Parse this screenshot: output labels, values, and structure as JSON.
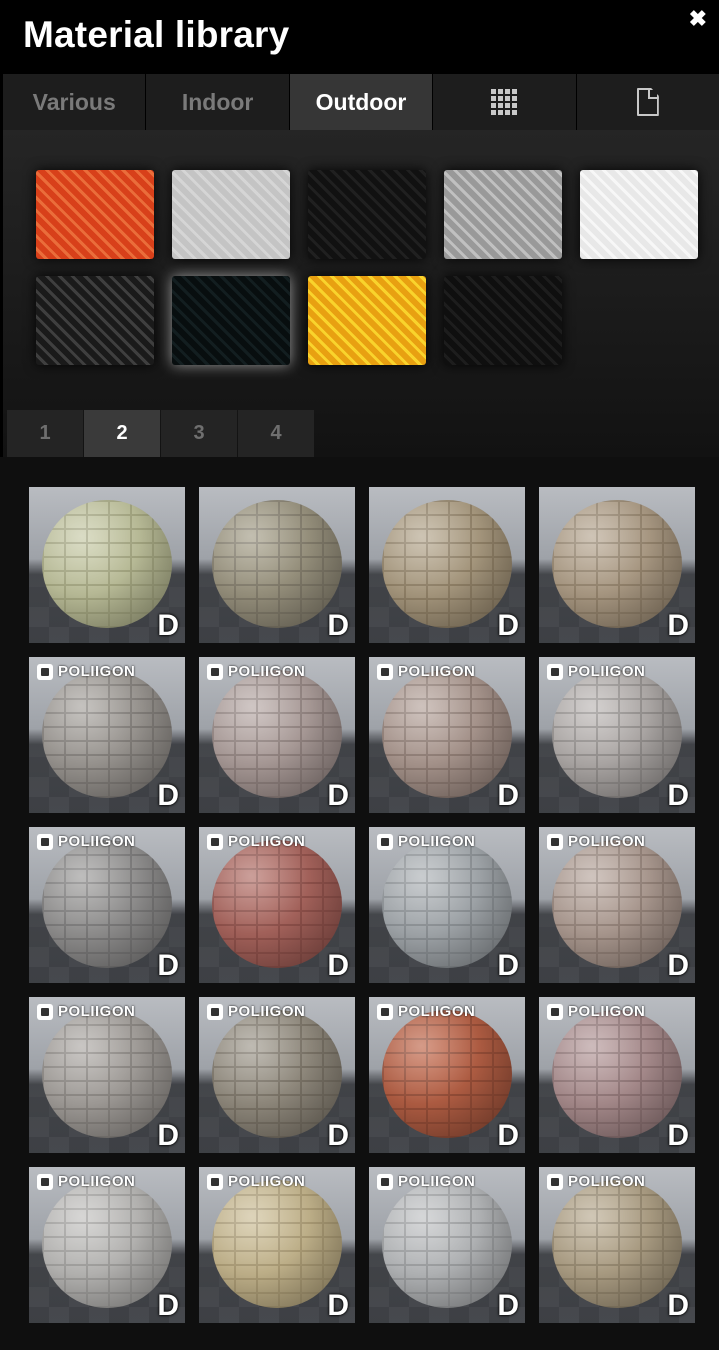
{
  "window": {
    "title": "Material library",
    "close_glyph": "✖"
  },
  "tabs": [
    {
      "label": "Various",
      "active": false
    },
    {
      "label": "Indoor",
      "active": false
    },
    {
      "label": "Outdoor",
      "active": true
    },
    {
      "icon": "grid-icon"
    },
    {
      "icon": "document-icon"
    }
  ],
  "swatches": [
    {
      "name": "brick",
      "colors": [
        "#b85a3a",
        "#d99a80"
      ]
    },
    {
      "name": "concrete",
      "colors": [
        "#a8a8a8",
        "#c2c2c2"
      ]
    },
    {
      "name": "glossy-dark",
      "colors": [
        "#2e2e2e",
        "#5a5a5a"
      ]
    },
    {
      "name": "metal-tread-plate",
      "colors": [
        "#8d8d8d",
        "#b8b8b8"
      ]
    },
    {
      "name": "white-plaster",
      "colors": [
        "#c9c9c9",
        "#ececec"
      ]
    },
    {
      "name": "roof-tiles",
      "colors": [
        "#3a3a3a",
        "#8a8a8a"
      ]
    },
    {
      "name": "dark-granite",
      "colors": [
        "#1f2a2c",
        "#4f5a5c"
      ],
      "selected": true
    },
    {
      "name": "osb-wood",
      "colors": [
        "#c9912e",
        "#f0cc7a"
      ]
    },
    {
      "name": "asphalt",
      "colors": [
        "#2c2c2c",
        "#555555"
      ]
    }
  ],
  "pages": [
    {
      "label": "1",
      "active": false
    },
    {
      "label": "2",
      "active": true
    },
    {
      "label": "3",
      "active": false
    },
    {
      "label": "4",
      "active": false
    }
  ],
  "badge_letter": "D",
  "brand_label": "POLIIGON",
  "materials": [
    {
      "brand": false,
      "colors": [
        "#c8cba8",
        "#9ea07c"
      ]
    },
    {
      "brand": false,
      "colors": [
        "#a49e88",
        "#7d7767"
      ]
    },
    {
      "brand": false,
      "colors": [
        "#b5a78e",
        "#8b7c63"
      ]
    },
    {
      "brand": false,
      "colors": [
        "#b7a792",
        "#8e7e68"
      ]
    },
    {
      "brand": true,
      "colors": [
        "#a8a49f",
        "#7e7a76"
      ]
    },
    {
      "brand": true,
      "colors": [
        "#b8aaa7",
        "#8c7e7b"
      ]
    },
    {
      "brand": true,
      "colors": [
        "#b6a49c",
        "#8a7870"
      ]
    },
    {
      "brand": true,
      "colors": [
        "#bdb8b6",
        "#8e8a88"
      ]
    },
    {
      "brand": true,
      "colors": [
        "#9d9c9b",
        "#767575"
      ]
    },
    {
      "brand": true,
      "colors": [
        "#b26e66",
        "#8a4e48"
      ]
    },
    {
      "brand": true,
      "colors": [
        "#aeb3b7",
        "#868b8f"
      ]
    },
    {
      "brand": true,
      "colors": [
        "#b8a79e",
        "#8e7d74"
      ]
    },
    {
      "brand": true,
      "colors": [
        "#aeaaa6",
        "#85817d"
      ]
    },
    {
      "brand": true,
      "colors": [
        "#9e988c",
        "#766f63"
      ]
    },
    {
      "brand": true,
      "colors": [
        "#c1674a",
        "#8f4a35"
      ]
    },
    {
      "brand": true,
      "colors": [
        "#b5999a",
        "#8a7071"
      ]
    },
    {
      "brand": true,
      "colors": [
        "#c3c2c0",
        "#9a9997"
      ]
    },
    {
      "brand": true,
      "colors": [
        "#cdbf98",
        "#a59671"
      ]
    },
    {
      "brand": true,
      "colors": [
        "#c1c3c5",
        "#96989a"
      ]
    },
    {
      "brand": true,
      "colors": [
        "#b9ab91",
        "#8f826a"
      ]
    }
  ]
}
